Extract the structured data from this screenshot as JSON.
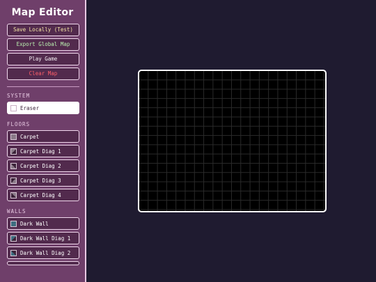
{
  "sidebar": {
    "title": "Map Editor",
    "actions": [
      {
        "label": "Save Locally (Test)",
        "color": "#f4e6a6"
      },
      {
        "label": "Export Global Map",
        "color": "#b9f0b0"
      },
      {
        "label": "Play Game",
        "color": "#f4eef3"
      },
      {
        "label": "Clear Map",
        "color": "#ff5f6a"
      }
    ],
    "system": {
      "label": "SYSTEM",
      "items": [
        {
          "label": "Eraser",
          "icon": "eraser-swatch-icon",
          "selected": true
        }
      ]
    },
    "floors": {
      "label": "FLOORS",
      "items": [
        {
          "label": "Carpet",
          "icon": "carpet-swatch-icon"
        },
        {
          "label": "Carpet Diag 1",
          "icon": "carpet-diag-swatch-icon"
        },
        {
          "label": "Carpet Diag 2",
          "icon": "carpet-diag-swatch-icon"
        },
        {
          "label": "Carpet Diag 3",
          "icon": "carpet-diag-swatch-icon"
        },
        {
          "label": "Carpet Diag 4",
          "icon": "carpet-diag-swatch-icon"
        }
      ]
    },
    "walls": {
      "label": "WALLS",
      "items": [
        {
          "label": "Dark Wall",
          "icon": "dark-wall-swatch-icon"
        },
        {
          "label": "Dark Wall Diag 1",
          "icon": "dark-wall-diag-swatch-icon"
        },
        {
          "label": "Dark Wall Diag 2",
          "icon": "dark-wall-diag-swatch-icon"
        }
      ]
    }
  },
  "colors": {
    "sidebar_bg": "#6f3f6a",
    "workspace_bg": "#1f1b30",
    "canvas_bg": "#000000",
    "grid_line": "#2a2a2a"
  }
}
